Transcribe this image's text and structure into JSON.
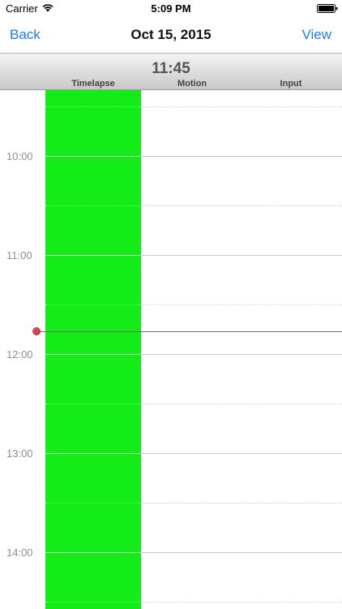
{
  "status_bar": {
    "carrier": "Carrier",
    "time": "5:09 PM",
    "wifi_icon": "wifi-icon",
    "battery_icon": "battery-icon"
  },
  "nav": {
    "back_label": "Back",
    "title": "Oct 15, 2015",
    "view_label": "View"
  },
  "header": {
    "current_time": "11:45",
    "columns": [
      "Timelapse",
      "Motion",
      "Input"
    ]
  },
  "timeline": {
    "hours": [
      "10:00",
      "11:00",
      "12:00",
      "13:00",
      "14:00"
    ],
    "now_marker_time": "11:45",
    "recording_bar": {
      "column": "Timelapse",
      "color": "#13ec17"
    }
  },
  "colors": {
    "accent": "#1a7cf3",
    "recording": "#13ec17",
    "now_marker": "#e0474c"
  }
}
